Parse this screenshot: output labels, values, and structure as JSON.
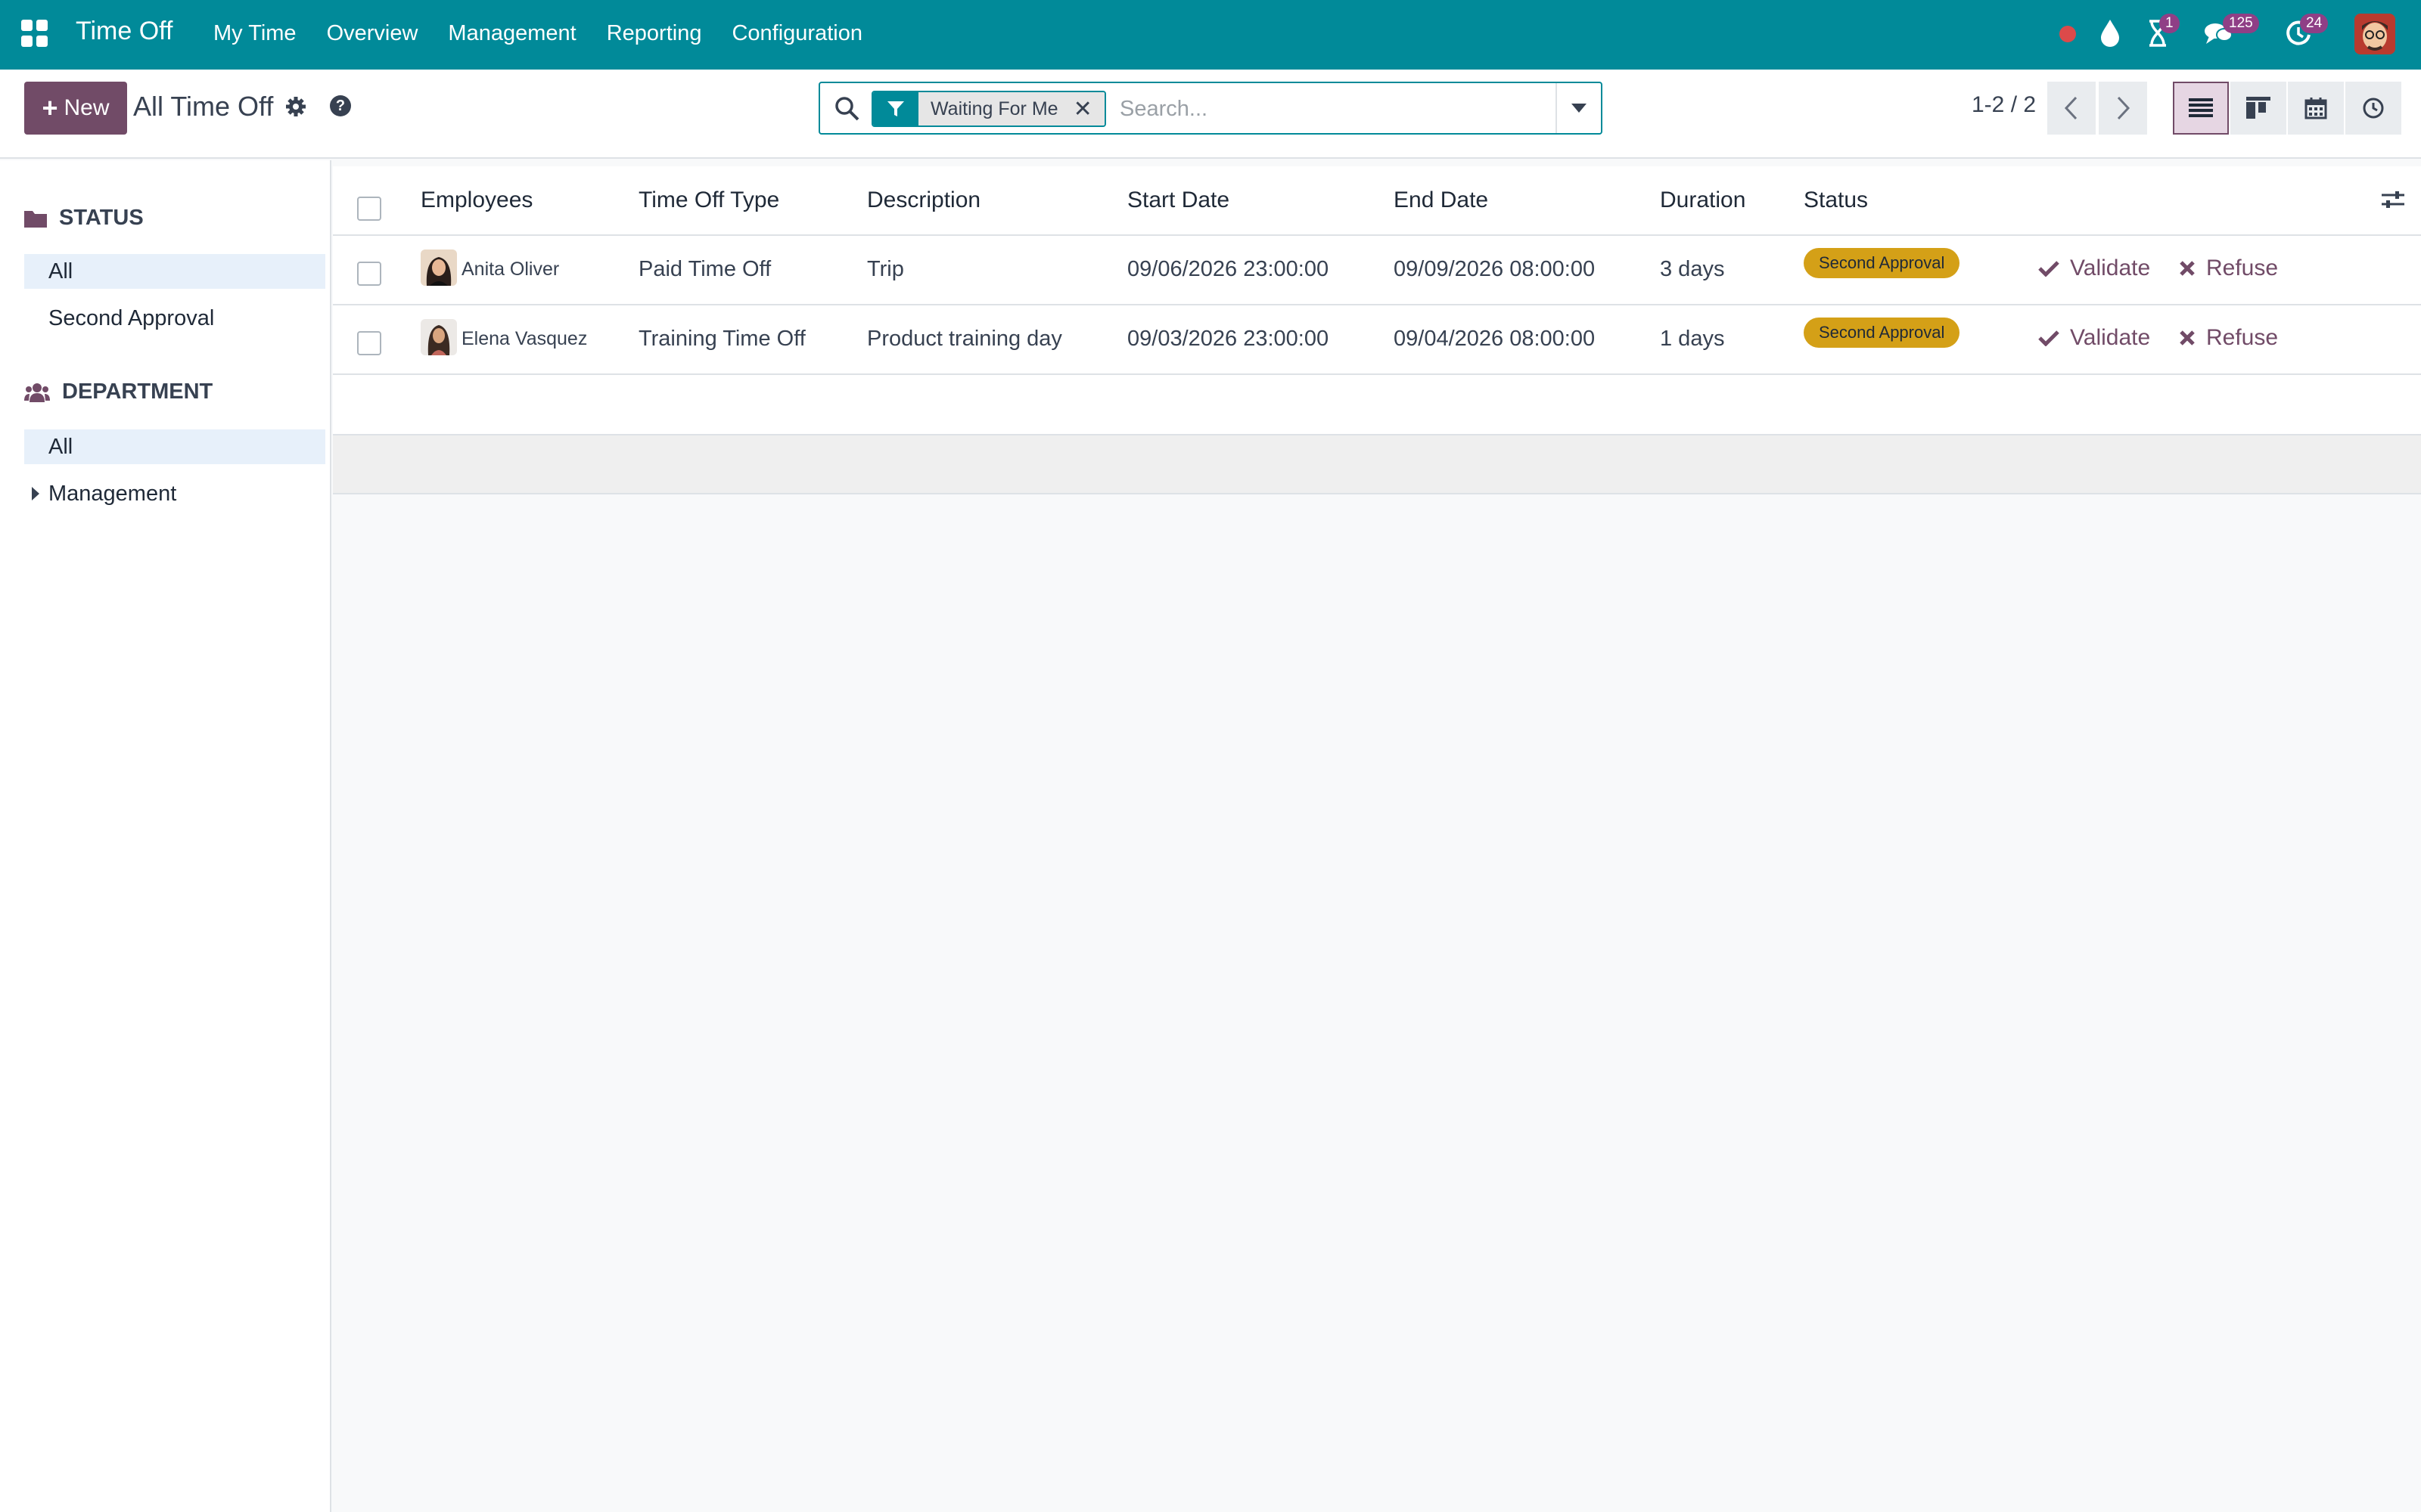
{
  "app": {
    "title": "Time Off"
  },
  "nav": {
    "items": [
      {
        "label": "My Time"
      },
      {
        "label": "Overview"
      },
      {
        "label": "Management"
      },
      {
        "label": "Reporting"
      },
      {
        "label": "Configuration"
      }
    ]
  },
  "systray": {
    "activities_count": "1",
    "messages_count": "125",
    "clock_count": "24"
  },
  "control": {
    "new_label": "New",
    "breadcrumb": "All Time Off",
    "pager": "1-2 / 2"
  },
  "search": {
    "facet": "Waiting For Me",
    "placeholder": "Search..."
  },
  "sidebar": {
    "status": {
      "title": "STATUS",
      "items": [
        {
          "label": "All"
        },
        {
          "label": "Second Approval"
        }
      ]
    },
    "department": {
      "title": "DEPARTMENT",
      "items": [
        {
          "label": "All"
        },
        {
          "label": "Management"
        }
      ]
    }
  },
  "table": {
    "columns": [
      "Employees",
      "Time Off Type",
      "Description",
      "Start Date",
      "End Date",
      "Duration",
      "Status"
    ],
    "rows": [
      {
        "employee": "Anita Oliver",
        "type": "Paid Time Off",
        "description": "Trip",
        "start": "09/06/2026 23:00:00",
        "end": "09/09/2026 08:00:00",
        "duration": "3 days",
        "status": "Second Approval",
        "validate": "Validate",
        "refuse": "Refuse"
      },
      {
        "employee": "Elena Vasquez",
        "type": "Training Time Off",
        "description": "Product training day",
        "start": "09/03/2026 23:00:00",
        "end": "09/04/2026 08:00:00",
        "duration": "1 days",
        "status": "Second Approval",
        "validate": "Validate",
        "refuse": "Refuse"
      }
    ]
  },
  "colors": {
    "topbar": "#018a99",
    "primary": "#714b67",
    "status_badge": "#d4a017"
  },
  "icons": [
    "apps-icon",
    "search-icon",
    "filter-icon",
    "gear-icon",
    "help-icon",
    "folder-icon",
    "users-icon",
    "list-view-icon",
    "kanban-view-icon",
    "calendar-view-icon",
    "activity-view-icon",
    "check-icon",
    "times-icon",
    "optional-columns-icon"
  ]
}
